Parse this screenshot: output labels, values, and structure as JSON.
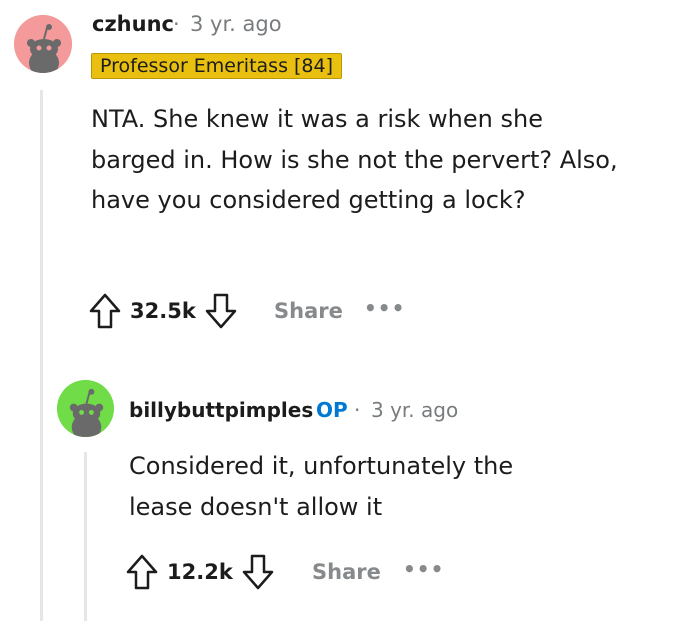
{
  "comments": [
    {
      "username": "czhunc",
      "age": "3 yr. ago",
      "flair": "Professor Emeritass [84]",
      "body": "NTA. She knew it was a risk when she barged in. How is she not the pervert? Also, have you considered getting a lock?",
      "votes": "32.5k",
      "share_label": "Share",
      "more_label": "•••",
      "avatar_color": "#f59a9a",
      "avatar_icon": "snoo-avatar-icon"
    },
    {
      "username": "billybuttpimples",
      "op_badge": "OP",
      "age": "3 yr. ago",
      "body": "Considered it, unfortunately the lease doesn't allow it",
      "votes": "12.2k",
      "share_label": "Share",
      "more_label": "•••",
      "avatar_color": "#6fdc48",
      "avatar_icon": "snoo-avatar-icon"
    }
  ],
  "separator": "·",
  "colors": {
    "flair_bg": "#e9c010",
    "op_blue": "#0079d3",
    "muted": "#787c7e",
    "thread_line": "#e6e6e6"
  }
}
